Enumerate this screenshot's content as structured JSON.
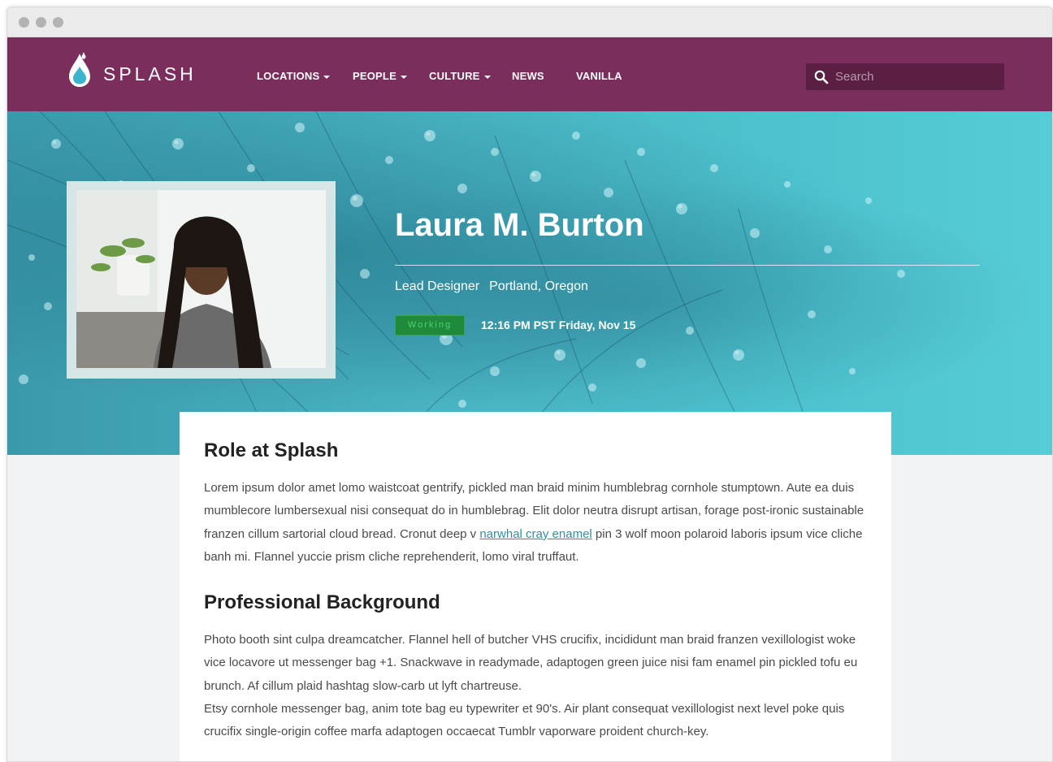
{
  "brand": {
    "name": "SPLASH"
  },
  "nav": {
    "items": [
      {
        "label": "LOCATIONS",
        "dropdown": true
      },
      {
        "label": "PEOPLE",
        "dropdown": true
      },
      {
        "label": "CULTURE",
        "dropdown": true
      },
      {
        "label": "NEWS",
        "dropdown": false
      },
      {
        "label": "VANILLA",
        "dropdown": false
      }
    ]
  },
  "search": {
    "placeholder": "Search",
    "value": ""
  },
  "profile": {
    "name": "Laura M. Burton",
    "title": "Lead Designer",
    "location": "Portland, Oregon",
    "status": "Working",
    "status_color": "#1f8a3c",
    "time": "12:16 PM PST Friday, Nov 15"
  },
  "role": {
    "heading": "Role at Splash",
    "text_before_link": "Lorem ipsum dolor amet lomo waistcoat gentrify, pickled man braid minim humblebrag cornhole stumptown. Aute ea duis mumblecore lumbersexual nisi consequat do in humblebrag. Elit dolor neutra disrupt artisan, forage post-ironic sustainable franzen cillum sartorial cloud bread. Cronut deep v ",
    "link": "narwhal cray enamel",
    "text_after_link": " pin 3 wolf moon polaroid laboris ipsum vice cliche banh mi. Flannel yuccie prism cliche reprehenderit, lomo viral truffaut."
  },
  "background": {
    "heading": "Professional Background",
    "paragraph1": "Photo booth sint culpa dreamcatcher. Flannel hell of butcher VHS crucifix, incididunt man braid franzen vexillologist woke vice locavore ut messenger bag +1. Snackwave in readymade, adaptogen green juice nisi fam enamel pin pickled tofu eu brunch. Af cillum plaid hashtag slow-carb ut lyft chartreuse.",
    "paragraph2": "Etsy cornhole messenger bag, anim tote bag eu typewriter et 90's. Air plant consequat vexillologist next level poke quis crucifix single-origin coffee marfa adaptogen occaecat Tumblr vaporware proident church-key."
  },
  "colors": {
    "header": "#7b2d5b",
    "hero": "#4ec3cf",
    "link": "#2e8fa6"
  },
  "icons": {
    "logo": "water-drop-icon",
    "search": "search-icon",
    "dropdown": "chevron-down-icon"
  }
}
